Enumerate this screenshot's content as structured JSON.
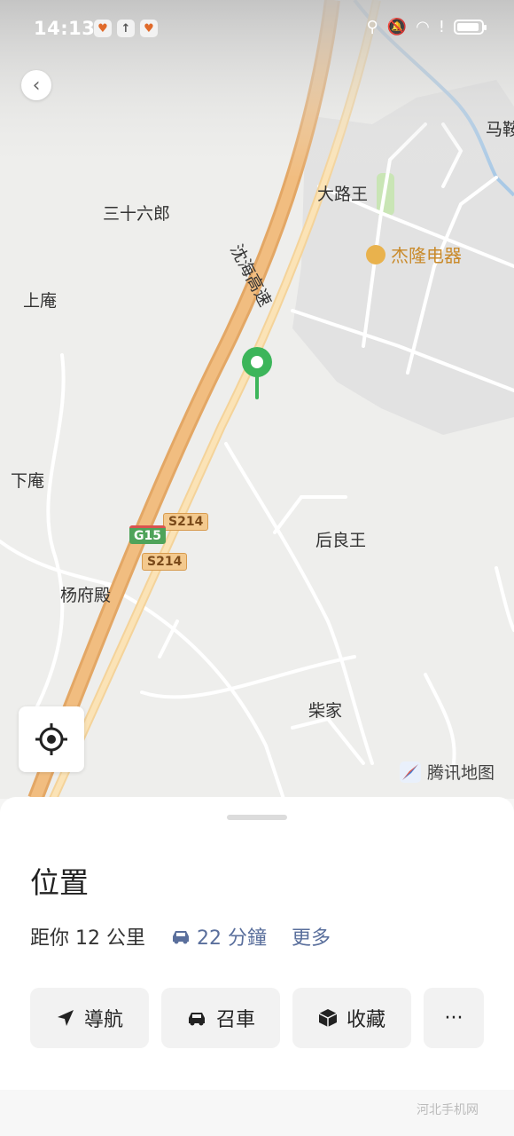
{
  "status_bar": {
    "time": "14:13",
    "left_icons": [
      "notification-app-icon",
      "upload-icon",
      "notification-app-icon"
    ],
    "right_icons": [
      "location-icon",
      "mute-icon",
      "wifi-icon",
      "alert-icon",
      "battery-icon"
    ],
    "battery_level": 0.8
  },
  "map": {
    "labels": {
      "mazhen": "马鞍",
      "dalu": "大路王",
      "sanshiliu": "三十六郎",
      "shanghai_road": "沈海高速",
      "shangan": "上庵",
      "xiaan": "下庵",
      "houliang": "后良王",
      "yangfu": "杨府殿",
      "chaijia": "柴家"
    },
    "poi": {
      "name": "杰隆电器",
      "icon": "shop-icon"
    },
    "shields": {
      "s214a": "S214",
      "s214b": "S214",
      "g15": "G15"
    },
    "logo_text": "腾讯地图",
    "colors": {
      "highway": "#eab06f",
      "road": "#ffffff",
      "built_area": "#e3e3e3",
      "pin": "#3cb55a"
    }
  },
  "sheet": {
    "title": "位置",
    "distance": "距你 12 公里",
    "drive_time": "22 分鐘",
    "more": "更多",
    "actions": {
      "navigate": "導航",
      "taxi": "召車",
      "favorite": "收藏",
      "more": "···"
    }
  },
  "watermark": "河北手机网"
}
